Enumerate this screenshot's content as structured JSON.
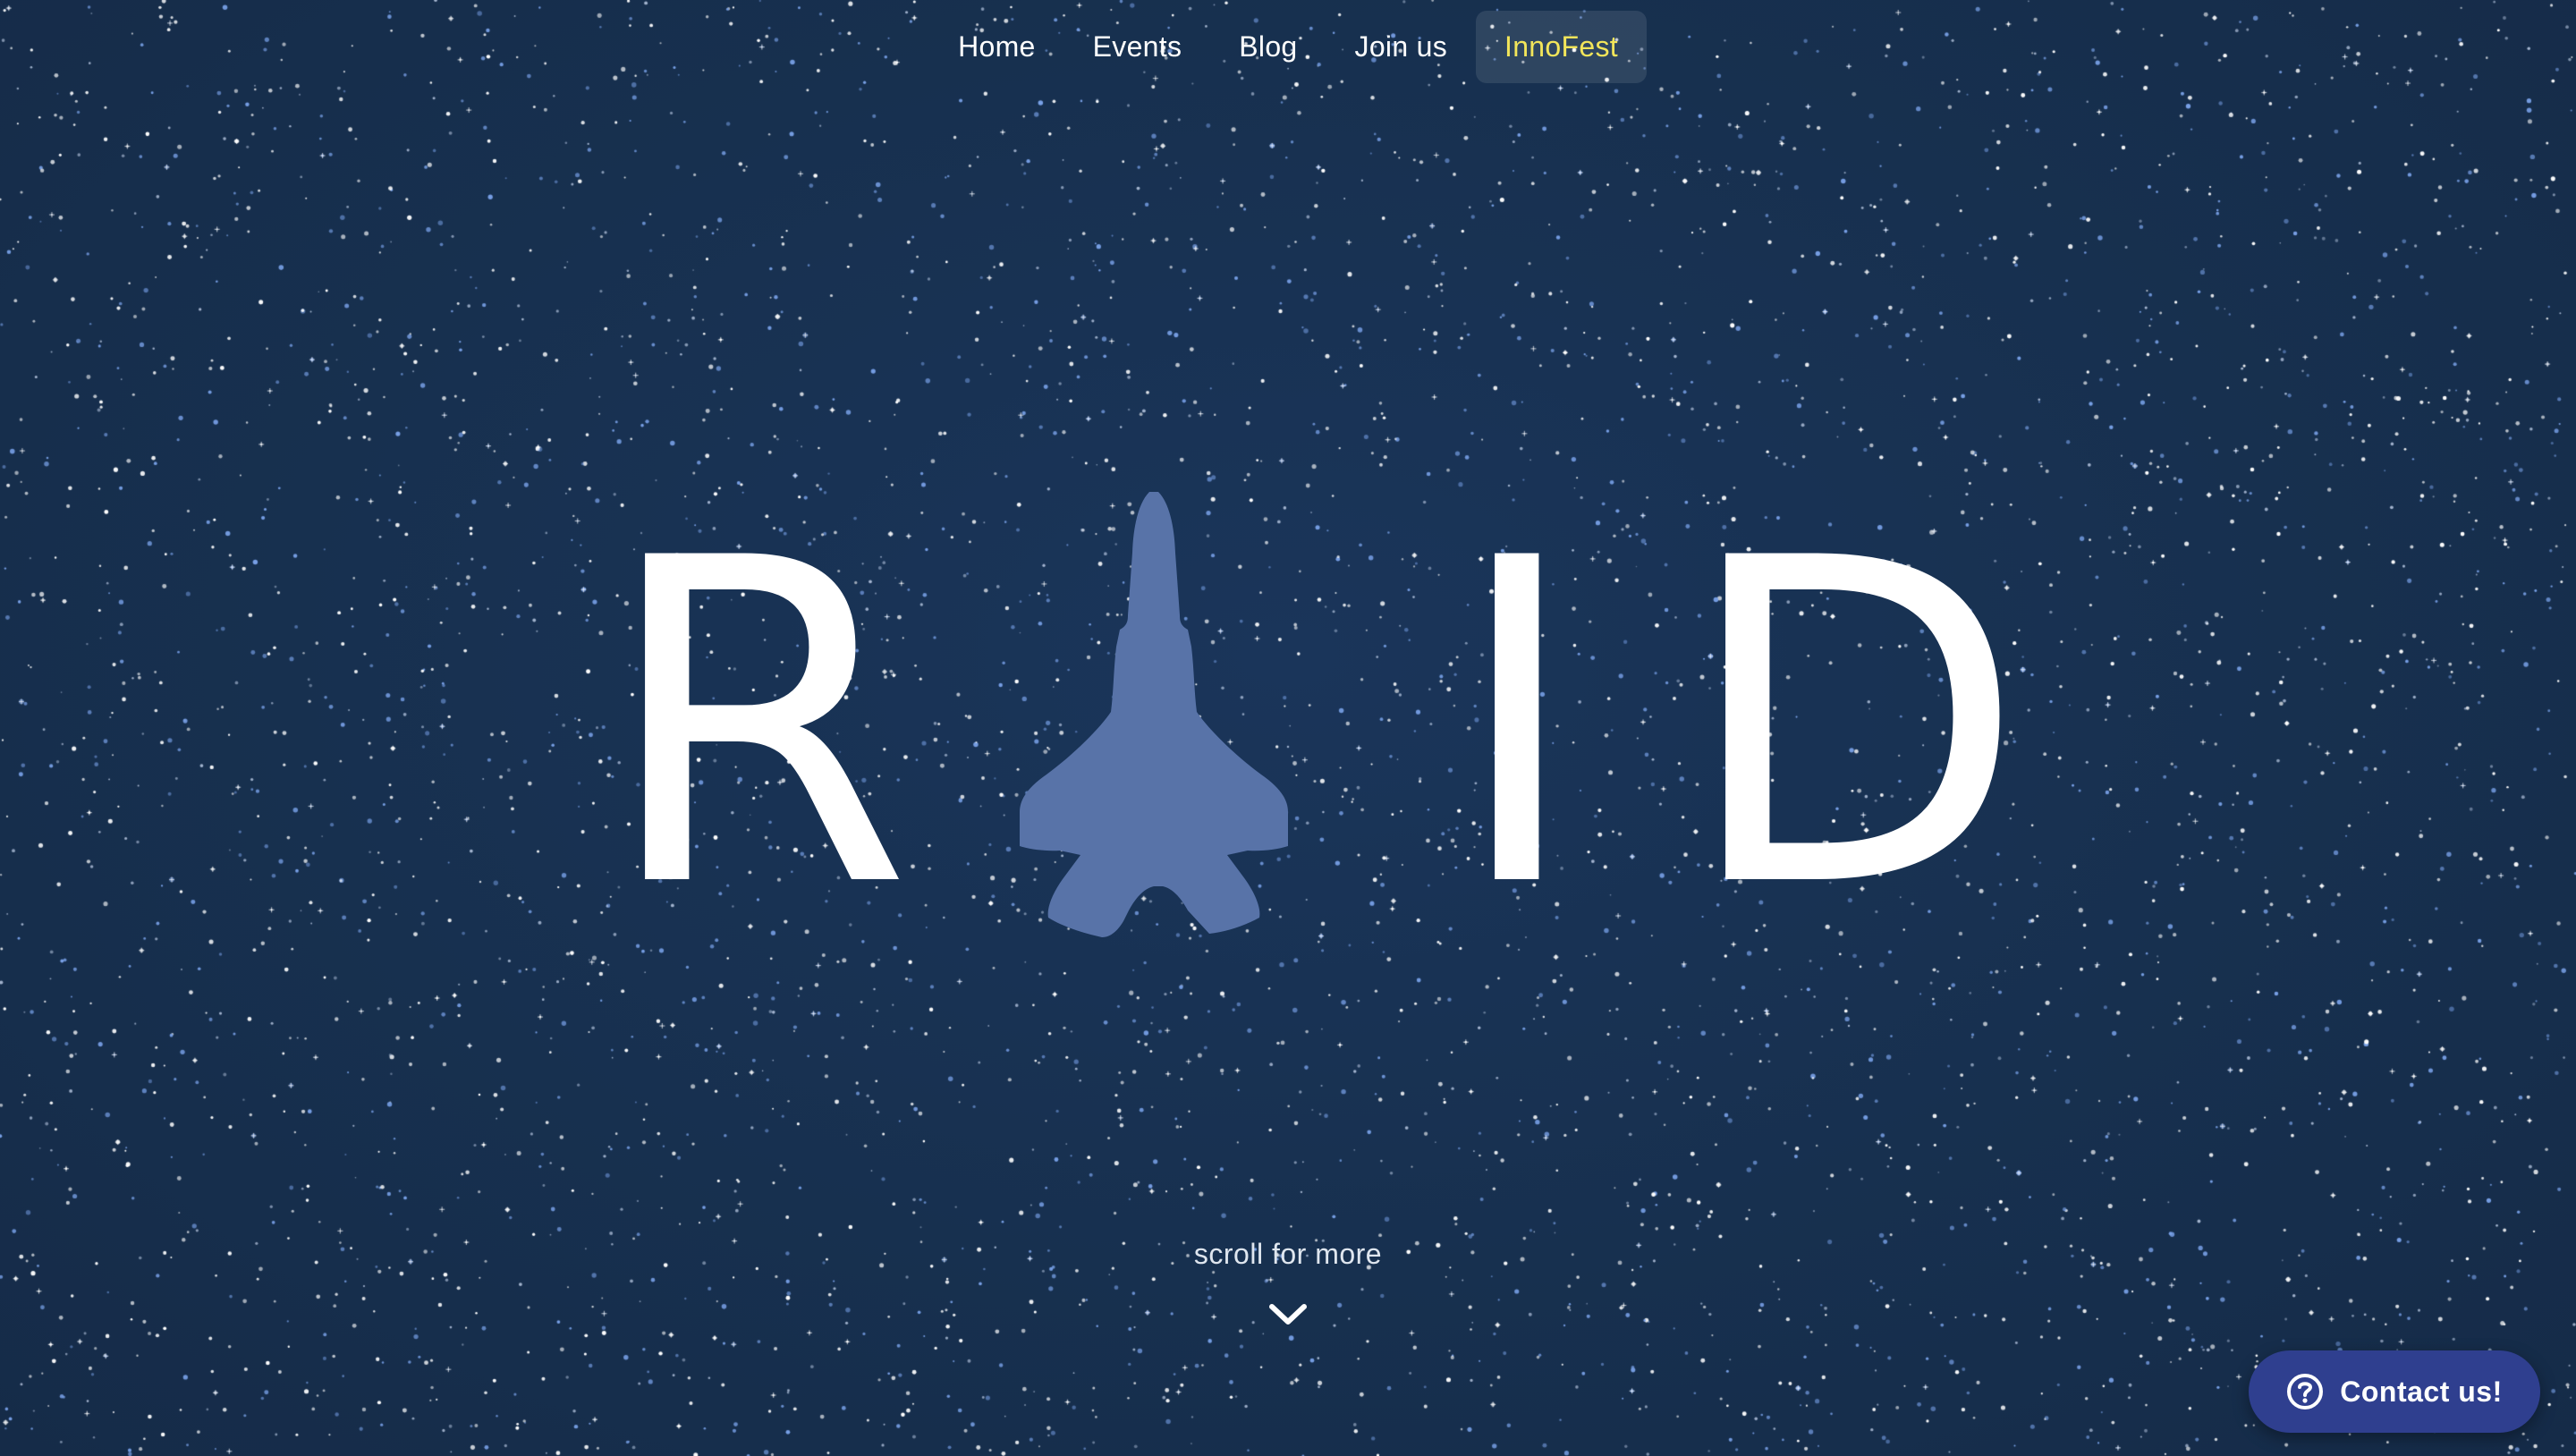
{
  "nav": {
    "items": [
      {
        "label": "Home"
      },
      {
        "label": "Events"
      },
      {
        "label": "Blog"
      },
      {
        "label": "Join us"
      },
      {
        "label": "InnoFest",
        "active": true
      }
    ]
  },
  "hero": {
    "letters": [
      "R",
      "I",
      "D"
    ],
    "logo_text": "RAID",
    "jet_icon": "fighter-jet-icon"
  },
  "scroll_hint": {
    "label": "scroll for more",
    "icon": "chevron-down-icon"
  },
  "contact": {
    "label": "Contact us!",
    "icon": "question-circle-icon"
  },
  "colors": {
    "background": "#17304f",
    "nav_text": "#ffffff",
    "nav_active_text": "#f2e55a",
    "jet": "#5873a8",
    "contact_button": "#2f3f8f"
  }
}
